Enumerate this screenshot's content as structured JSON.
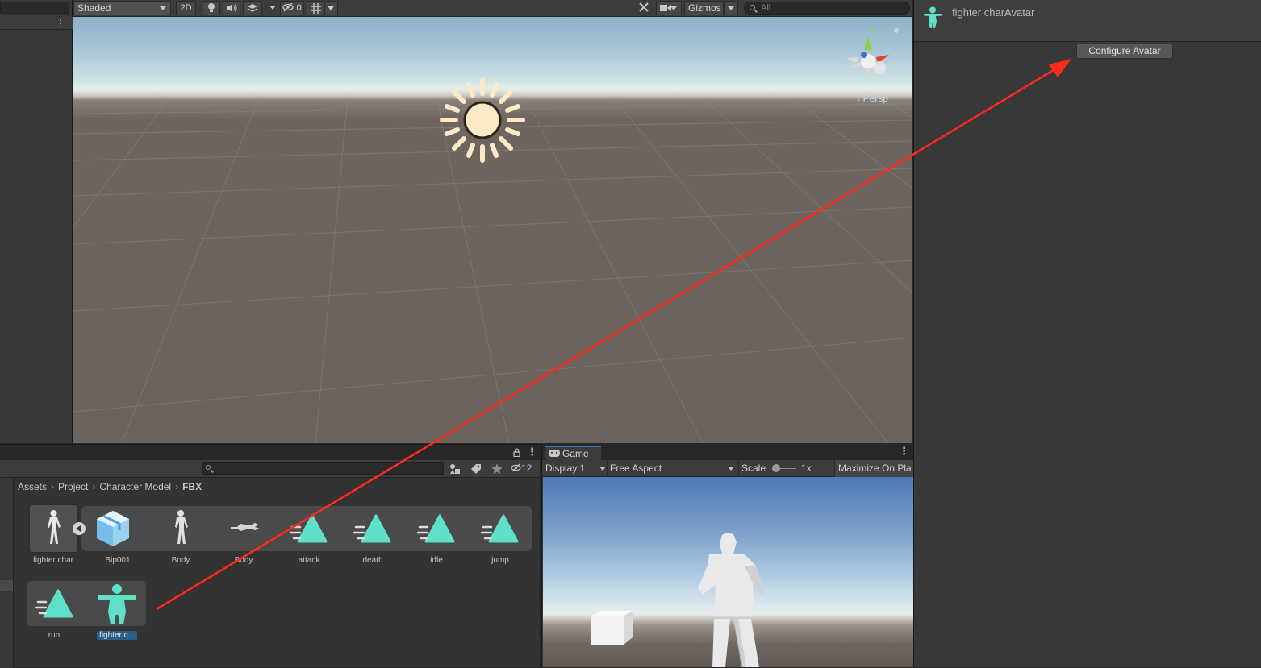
{
  "scene_toolbar": {
    "shading_mode": "Shaded",
    "mode_2d": "2D",
    "hidden_count": "0",
    "gizmos": "Gizmos",
    "search_placeholder": "All"
  },
  "scene_view": {
    "projection": "Persp",
    "axis_y": "y"
  },
  "inspector": {
    "title": "fighter charAvatar",
    "configure_button": "Configure Avatar"
  },
  "project": {
    "hidden_count": "12",
    "breadcrumb": [
      "Assets",
      "Project",
      "Character Model",
      "FBX"
    ],
    "assets": [
      {
        "label": "fighter char",
        "icon": "model-icon"
      },
      {
        "label": "Bip001",
        "icon": "prefab-icon"
      },
      {
        "label": "Body",
        "icon": "mesh-figure-icon"
      },
      {
        "label": "Body",
        "icon": "mesh-lying-icon"
      },
      {
        "label": "attack",
        "icon": "animation-clip-icon"
      },
      {
        "label": "death",
        "icon": "animation-clip-icon"
      },
      {
        "label": "idle",
        "icon": "animation-clip-icon"
      },
      {
        "label": "jump",
        "icon": "animation-clip-icon"
      },
      {
        "label": "run",
        "icon": "animation-clip-icon"
      },
      {
        "label": "fighter c...",
        "icon": "avatar-icon",
        "selected": true
      }
    ]
  },
  "game": {
    "tab_label": "Game",
    "display": "Display 1",
    "aspect": "Free Aspect",
    "scale_label": "Scale",
    "scale_value": "1x",
    "maximize": "Maximize On Pla"
  },
  "colors": {
    "accent_teal": "#5fe0c8",
    "selection_blue": "#2c5d87",
    "annotation_red": "#ff2a1a"
  }
}
